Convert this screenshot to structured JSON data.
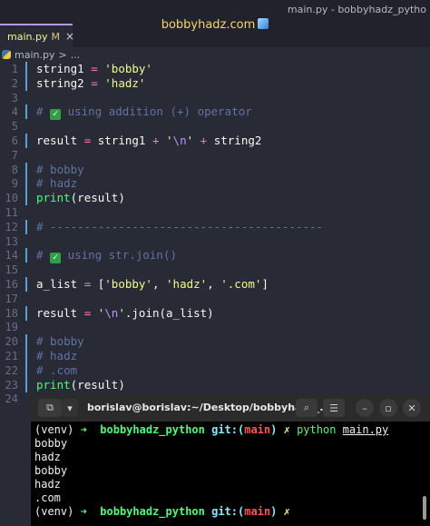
{
  "window": {
    "title": "main.py - bobbyhadz_pytho",
    "center_title": "bobbyhadz.com"
  },
  "tab": {
    "label": "main.py",
    "modified": "M",
    "close": "×"
  },
  "breadcrumb": {
    "file": "main.py",
    "sep": ">",
    "rest": "..."
  },
  "editor": {
    "lines": [
      {
        "n": "1",
        "tokens": [
          {
            "t": "string1 ",
            "c": "var"
          },
          {
            "t": "=",
            "c": "op"
          },
          {
            "t": " 'bobby'",
            "c": "str"
          }
        ]
      },
      {
        "n": "2",
        "tokens": [
          {
            "t": "string2 ",
            "c": "var"
          },
          {
            "t": "=",
            "c": "op"
          },
          {
            "t": " 'hadz'",
            "c": "str"
          }
        ]
      },
      {
        "n": "3",
        "tokens": []
      },
      {
        "n": "4",
        "tokens": [
          {
            "t": "# ",
            "c": "cmt"
          },
          {
            "t": "✓",
            "c": "chk"
          },
          {
            "t": " using addition (+) operator",
            "c": "cmt"
          }
        ]
      },
      {
        "n": "5",
        "tokens": []
      },
      {
        "n": "6",
        "tokens": [
          {
            "t": "result ",
            "c": "var"
          },
          {
            "t": "=",
            "c": "op"
          },
          {
            "t": " string1 ",
            "c": "var"
          },
          {
            "t": "+",
            "c": "op"
          },
          {
            "t": " '",
            "c": "str"
          },
          {
            "t": "\\n",
            "c": "esc"
          },
          {
            "t": "' ",
            "c": "str"
          },
          {
            "t": "+",
            "c": "op"
          },
          {
            "t": " string2",
            "c": "var"
          }
        ]
      },
      {
        "n": "7",
        "tokens": []
      },
      {
        "n": "8",
        "tokens": [
          {
            "t": "# bobby",
            "c": "cmt"
          }
        ]
      },
      {
        "n": "9",
        "tokens": [
          {
            "t": "# hadz",
            "c": "cmt"
          }
        ]
      },
      {
        "n": "10",
        "tokens": [
          {
            "t": "print",
            "c": "fn"
          },
          {
            "t": "(result)",
            "c": "pun"
          }
        ]
      },
      {
        "n": "11",
        "tokens": []
      },
      {
        "n": "12",
        "tokens": [
          {
            "t": "# ----------------------------------------",
            "c": "cmt"
          }
        ]
      },
      {
        "n": "13",
        "tokens": []
      },
      {
        "n": "14",
        "tokens": [
          {
            "t": "# ",
            "c": "cmt"
          },
          {
            "t": "✓",
            "c": "chk"
          },
          {
            "t": " using str.join()",
            "c": "cmt"
          }
        ]
      },
      {
        "n": "15",
        "tokens": []
      },
      {
        "n": "16",
        "tokens": [
          {
            "t": "a_list ",
            "c": "var"
          },
          {
            "t": "=",
            "c": "op"
          },
          {
            "t": " [",
            "c": "pun"
          },
          {
            "t": "'bobby'",
            "c": "str"
          },
          {
            "t": ", ",
            "c": "pun"
          },
          {
            "t": "'hadz'",
            "c": "str"
          },
          {
            "t": ", ",
            "c": "pun"
          },
          {
            "t": "'.com'",
            "c": "str"
          },
          {
            "t": "]",
            "c": "pun"
          }
        ]
      },
      {
        "n": "17",
        "tokens": []
      },
      {
        "n": "18",
        "tokens": [
          {
            "t": "result ",
            "c": "var"
          },
          {
            "t": "=",
            "c": "op"
          },
          {
            "t": " '",
            "c": "str"
          },
          {
            "t": "\\n",
            "c": "esc"
          },
          {
            "t": "'",
            "c": "str"
          },
          {
            "t": ".join(a_list)",
            "c": "pun"
          }
        ]
      },
      {
        "n": "19",
        "tokens": []
      },
      {
        "n": "20",
        "tokens": [
          {
            "t": "# bobby",
            "c": "cmt"
          }
        ]
      },
      {
        "n": "21",
        "tokens": [
          {
            "t": "# hadz",
            "c": "cmt"
          }
        ]
      },
      {
        "n": "22",
        "tokens": [
          {
            "t": "# .com",
            "c": "cmt"
          }
        ]
      },
      {
        "n": "23",
        "tokens": [
          {
            "t": "print",
            "c": "fn"
          },
          {
            "t": "(result)",
            "c": "pun"
          }
        ]
      },
      {
        "n": "24",
        "tokens": []
      }
    ]
  },
  "terminal": {
    "title": "borislav@borislav:~/Desktop/bobbyhadz_...",
    "prompt_venv": "(venv)",
    "prompt_arrow": "➜",
    "prompt_dir": "bobbyhadz_python",
    "prompt_git": "git:(",
    "prompt_branch": "main",
    "prompt_git_close": ")",
    "prompt_x": "✗",
    "command": "python",
    "command_arg": "main.py",
    "output": [
      "bobby",
      "hadz",
      "bobby",
      "hadz",
      ".com"
    ]
  }
}
